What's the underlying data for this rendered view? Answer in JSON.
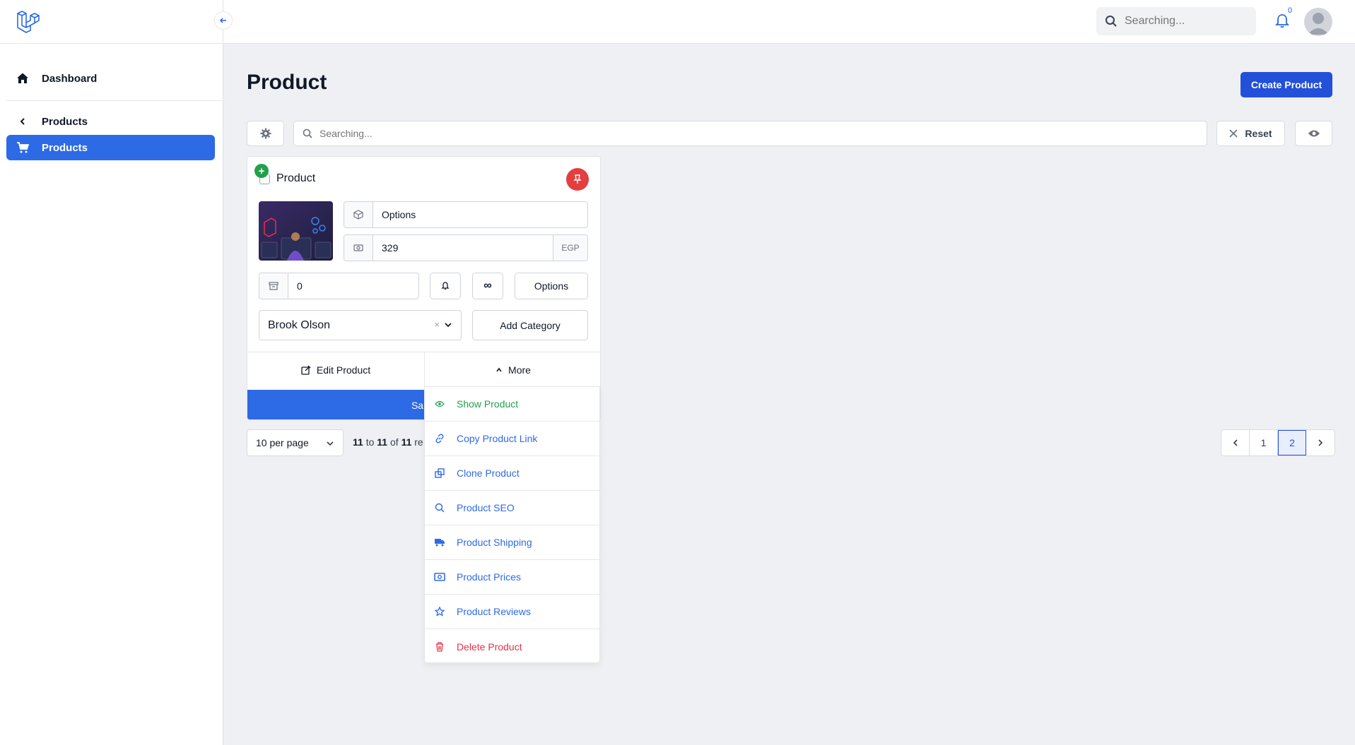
{
  "header": {
    "search_placeholder": "Searching...",
    "notification_count": "0"
  },
  "sidebar": {
    "items": [
      {
        "label": "Dashboard",
        "icon": "home-icon"
      },
      {
        "label": "Products",
        "icon": "chevron-left-icon"
      },
      {
        "label": "Products",
        "icon": "cart-icon",
        "active": true
      }
    ]
  },
  "main": {
    "title": "Product",
    "create_button": "Create Product",
    "search_placeholder": "Searching...",
    "reset_label": "Reset"
  },
  "card": {
    "title": "Product",
    "type_value": "Options",
    "price_value": "329",
    "currency": "EGP",
    "stock_value": "0",
    "options_label": "Options",
    "owner_value": "Brook Olson",
    "add_category_label": "Add Category",
    "edit_label": "Edit Product",
    "more_label": "More",
    "save_label": "Sa"
  },
  "dropdown": {
    "items": [
      {
        "label": "Show Product",
        "icon": "eye-icon",
        "color": "#22a04b"
      },
      {
        "label": "Copy Product Link",
        "icon": "link-icon",
        "color": "#2d6ae5"
      },
      {
        "label": "Clone Product",
        "icon": "clone-icon",
        "color": "#2d6ae5"
      },
      {
        "label": "Product SEO",
        "icon": "search-icon",
        "color": "#2d6ae5"
      },
      {
        "label": "Product Shipping",
        "icon": "truck-icon",
        "color": "#2d6ae5"
      },
      {
        "label": "Product Prices",
        "icon": "money-icon",
        "color": "#2d6ae5"
      },
      {
        "label": "Product Reviews",
        "icon": "star-icon",
        "color": "#2d6ae5"
      },
      {
        "label": "Delete Product",
        "icon": "trash-icon",
        "color": "#e0344a"
      }
    ]
  },
  "pagination": {
    "per_page": "10 per page",
    "from": "11",
    "to_word": "to",
    "to": "11",
    "of_word": "of",
    "total": "11",
    "results_tail": "re",
    "pages": [
      "1",
      "2"
    ],
    "current_page": "2"
  },
  "colors": {
    "primary": "#2d6ae5",
    "danger": "#e53e3e",
    "success": "#22a04b"
  }
}
